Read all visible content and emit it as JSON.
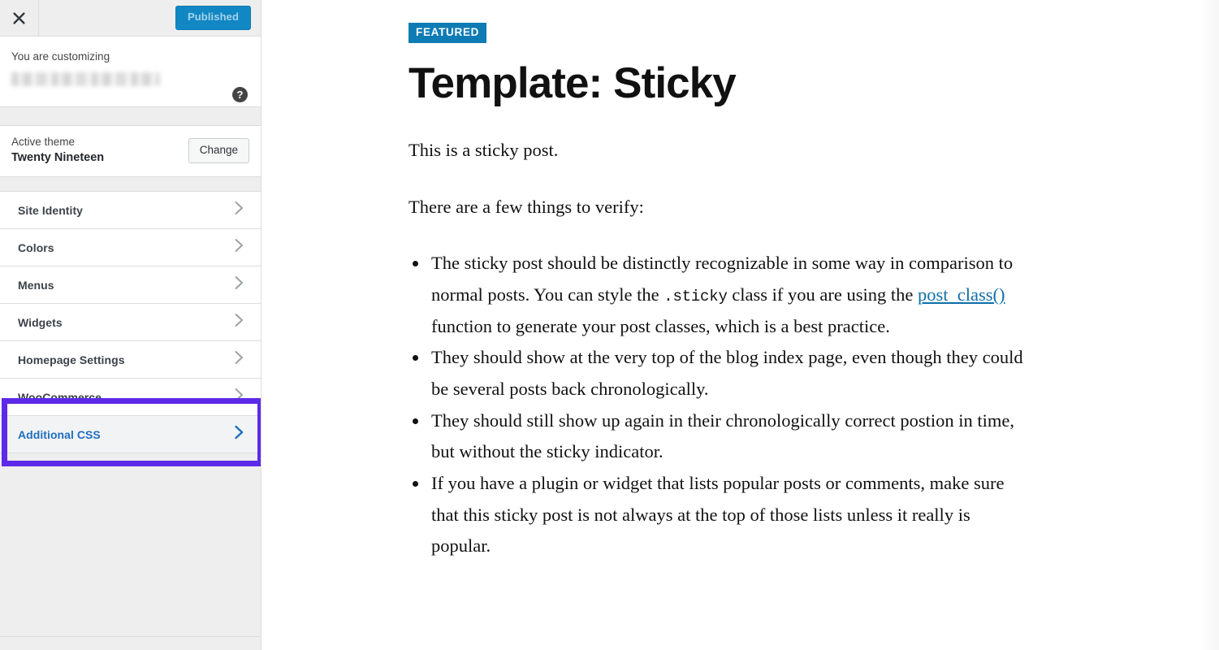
{
  "customizer": {
    "header": {
      "close_icon": "close-x-icon",
      "publish_label": "Published"
    },
    "info": {
      "customizing_label": "You are customizing",
      "site_title_redacted": "",
      "help_icon": "question-mark-icon",
      "help_label": "?"
    },
    "theme": {
      "eyebrow": "Active theme",
      "name": "Twenty Nineteen",
      "change_label": "Change"
    },
    "sections": [
      {
        "label": "Site Identity",
        "focused": false
      },
      {
        "label": "Colors",
        "focused": false
      },
      {
        "label": "Menus",
        "focused": false
      },
      {
        "label": "Widgets",
        "focused": false
      },
      {
        "label": "Homepage Settings",
        "focused": false
      },
      {
        "label": "WooCommerce",
        "focused": false
      },
      {
        "label": "Additional CSS",
        "focused": true
      }
    ],
    "highlight_color": "#5c2ae8"
  },
  "preview": {
    "badge": "FEATURED",
    "title": "Template: Sticky",
    "paragraphs": [
      "This is a sticky post.",
      "There are a few things to verify:"
    ],
    "bullets": [
      {
        "part1": "The sticky post should be distinctly recognizable in some way in comparison to normal posts. You can style the ",
        "code": ".sticky",
        "part2": " class if you are using the ",
        "link": "post_class()",
        "part3": " function to generate your post classes, which is a best practice."
      },
      {
        "part1": "They should show at the very top of the blog index page, even though they could be several posts back chronologically.",
        "code": "",
        "part2": "",
        "link": "",
        "part3": ""
      },
      {
        "part1": "They should still show up again in their chronologically correct postion in time, but without the sticky indicator.",
        "code": "",
        "part2": "",
        "link": "",
        "part3": ""
      },
      {
        "part1": "If you have a plugin or widget that lists popular posts or comments, make sure that this sticky post is not always at the top of those lists unless it really is popular.",
        "code": "",
        "part2": "",
        "link": "",
        "part3": ""
      }
    ],
    "badge_color": "#0e7bb4",
    "link_color": "#0f6fa8"
  }
}
